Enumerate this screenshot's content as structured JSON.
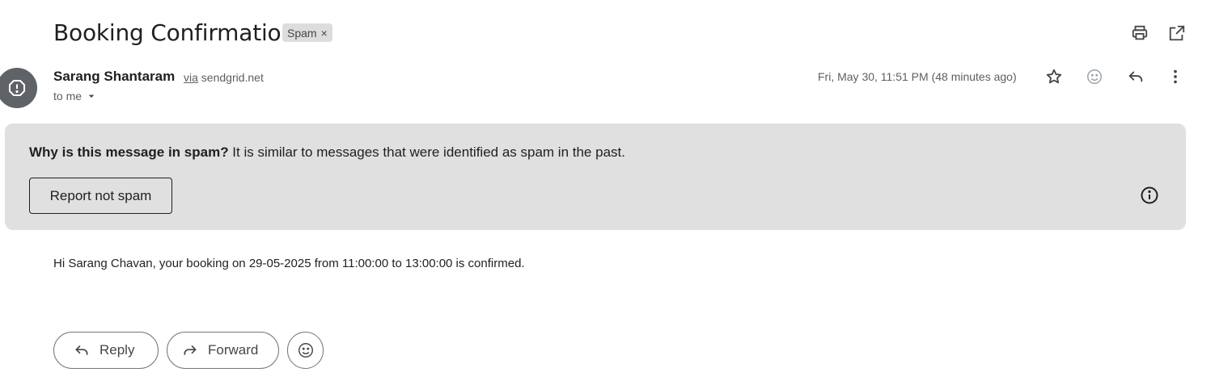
{
  "email": {
    "subject": "Booking Confirmation",
    "label": "Spam",
    "label_remove": "×",
    "sender": {
      "name": "Sarang Shantaram",
      "via_label": "via",
      "via_domain": "sendgrid.net",
      "recipient": "to me"
    },
    "datetime": "Fri, May 30, 11:51 PM (48 minutes ago)",
    "body": "Hi Sarang Chavan, your booking on 29-05-2025 from 11:00:00 to 13:00:00 is confirmed."
  },
  "spam_banner": {
    "question": "Why is this message in spam?",
    "reason": " It is similar to messages that were identified as spam in the past.",
    "report_button": "Report not spam"
  },
  "actions": {
    "reply": "Reply",
    "forward": "Forward"
  },
  "icons": {
    "print": "print-icon",
    "popout": "open-in-new-window-icon",
    "star": "star-icon",
    "emoji": "emoji-reaction-icon",
    "reply": "reply-icon",
    "more": "more-vertical-icon",
    "info": "info-icon",
    "warning": "spam-warning-icon",
    "forward": "forward-icon",
    "dropdown": "caret-down-icon"
  },
  "colors": {
    "banner_bg": "#e0e0e0",
    "chip_bg": "#dddddd",
    "avatar_bg": "#5f6368",
    "text_primary": "#1f1f1f",
    "text_secondary": "#5e5e5e"
  }
}
